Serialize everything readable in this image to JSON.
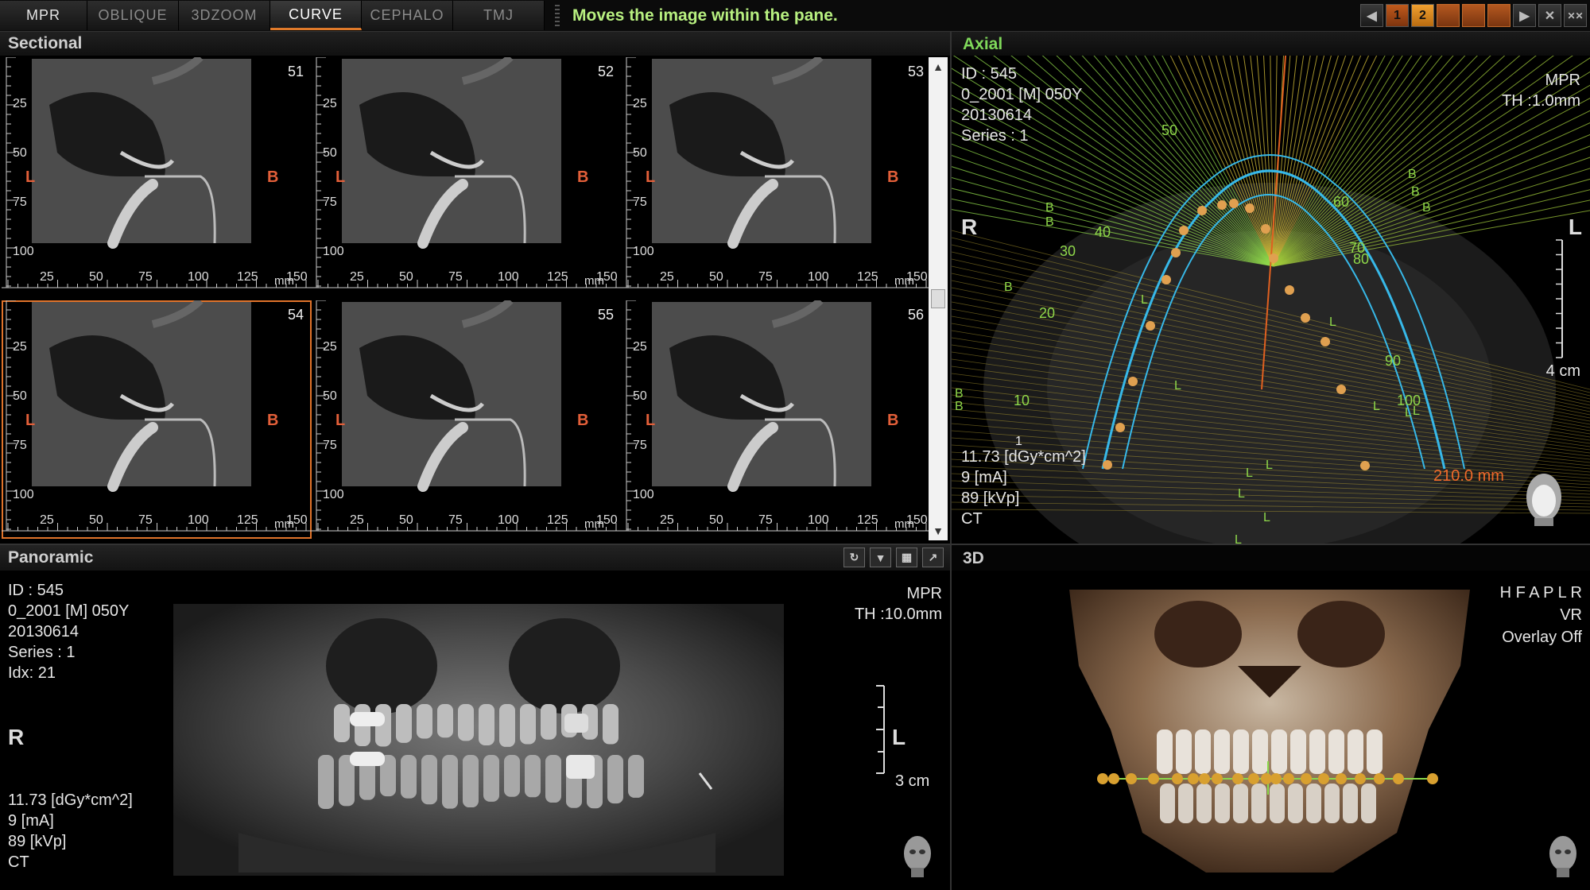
{
  "tabs": [
    {
      "label": "MPR",
      "active": false
    },
    {
      "label": "OBLIQUE",
      "active": false
    },
    {
      "label": "3DZOOM",
      "active": false
    },
    {
      "label": "CURVE",
      "active": true
    },
    {
      "label": "CEPHALO",
      "active": false
    },
    {
      "label": "TMJ",
      "active": false
    }
  ],
  "hint": "Moves the image within the pane.",
  "window_controls": {
    "page1": "1",
    "page2": "2"
  },
  "sectional": {
    "title": "Sectional",
    "unit": "mm",
    "y_ticks": [
      "25",
      "50",
      "75",
      "100"
    ],
    "x_ticks": [
      "25",
      "50",
      "75",
      "100",
      "125",
      "150"
    ],
    "left_label": "L",
    "right_label": "B",
    "cells": [
      {
        "num": "51"
      },
      {
        "num": "52"
      },
      {
        "num": "53"
      },
      {
        "num": "54",
        "selected": true
      },
      {
        "num": "55"
      },
      {
        "num": "56"
      }
    ]
  },
  "axial": {
    "title": "Axial",
    "info": [
      "ID : 545",
      "0_2001 [M] 050Y",
      "20130614",
      "Series : 1"
    ],
    "mode": "MPR",
    "thickness": "TH :1.0mm",
    "orient_left": "R",
    "orient_right": "L",
    "dose": [
      "11.73  [dGy*cm^2]",
      "9  [mA]",
      "89 [kVp]",
      "CT"
    ],
    "scale": "4 cm",
    "length": "210.0 mm",
    "angle_labels": [
      "10",
      "20",
      "30",
      "40",
      "50",
      "60",
      "70",
      "80",
      "90",
      "100"
    ],
    "curve_labels": [
      "B",
      "L",
      "1"
    ]
  },
  "panoramic": {
    "title": "Panoramic",
    "info": [
      "ID : 545",
      "0_2001 [M] 050Y",
      "20130614",
      "Series : 1",
      "Idx: 21"
    ],
    "mode": "MPR",
    "thickness": "TH :10.0mm",
    "orient_left": "R",
    "orient_right": "L",
    "dose": [
      "11.73  [dGy*cm^2]",
      "9  [mA]",
      "89 [kVp]",
      "CT"
    ],
    "scale": "3 cm"
  },
  "view3d": {
    "title": "3D",
    "info": [
      "H F A P L R",
      "VR",
      "Overlay Off"
    ]
  },
  "colors": {
    "accent": "#e0732a",
    "hint": "#b8f080",
    "axial_title": "#7fd85a",
    "side_label": "#e35f39",
    "curve": "#37b8e8"
  }
}
